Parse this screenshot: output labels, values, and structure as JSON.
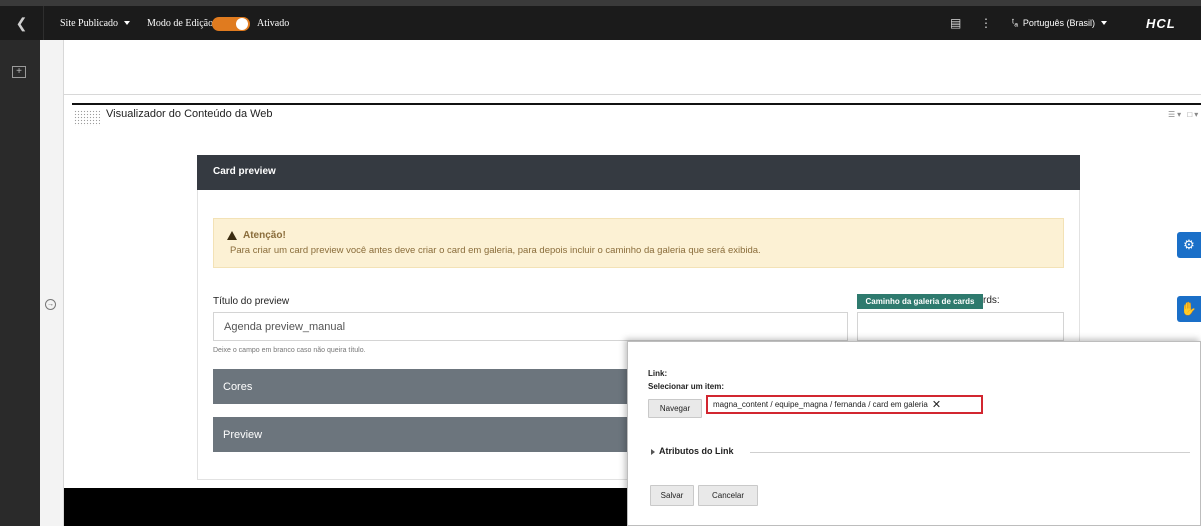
{
  "topbar": {
    "back_icon": "chevron-left-icon",
    "site_label": "Site Publicado",
    "edit_mode_label": "Modo de Edição:",
    "edit_mode_state": "Ativado",
    "toggle_color": "#e07b1f",
    "language": "Português (Brasil)",
    "brand": "HCL"
  },
  "portlet": {
    "title": "Visualizador do Conteúdo da Web"
  },
  "card": {
    "header": "Card preview",
    "alert_title": "Atenção!",
    "alert_message": "Para criar um card preview você antes deve criar o card em galeria, para depois incluir o caminho da galeria que será exibida.",
    "title_label": "Título do preview",
    "title_value": "Agenda preview_manual",
    "title_help": "Deixe o campo em branco caso não queira título.",
    "gallery_badge": "Caminho da galeria de cards",
    "gallery_label_suffix": "rds:",
    "accordion_colors": "Cores",
    "accordion_preview": "Preview"
  },
  "modal": {
    "link_label": "Link:",
    "select_label": "Selecionar um item:",
    "navigate_button": "Navegar",
    "selected_path": "magna_content / equipe_magna / fernanda / card em galeria",
    "clear_icon": "close-icon",
    "link_attributes": "Atributos do Link",
    "save_button": "Salvar",
    "cancel_button": "Cancelar"
  },
  "colors": {
    "topbar": "#1b1b1b",
    "card_header": "#353a41",
    "accordion": "#6c757d",
    "alert_bg": "#fcf1d4",
    "gallery_badge": "#2e7a6e",
    "highlight_border": "#d22630",
    "side_buttons": "#1a6fc8"
  }
}
